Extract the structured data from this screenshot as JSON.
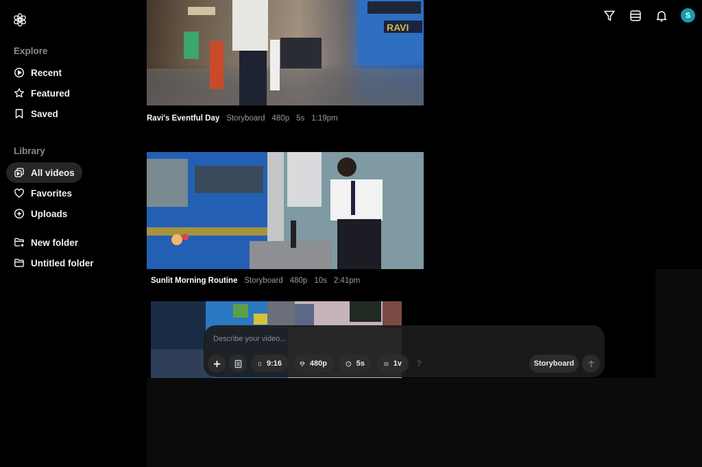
{
  "sidebar": {
    "logo": "openai-logo-icon",
    "explore_label": "Explore",
    "explore_items": [
      {
        "label": "Recent",
        "icon": "play-circle-icon"
      },
      {
        "label": "Featured",
        "icon": "star-icon"
      },
      {
        "label": "Saved",
        "icon": "bookmark-icon"
      }
    ],
    "library_label": "Library",
    "library_items": [
      {
        "label": "All videos",
        "icon": "videos-icon",
        "active": true
      },
      {
        "label": "Favorites",
        "icon": "heart-icon"
      },
      {
        "label": "Uploads",
        "icon": "plus-circle-icon"
      }
    ],
    "folder_items": [
      {
        "label": "New folder",
        "icon": "folder-plus-icon"
      },
      {
        "label": "Untitled folder",
        "icon": "folder-icon"
      }
    ]
  },
  "topbar": {
    "icons": [
      "filter-icon",
      "list-icon",
      "bell-icon"
    ],
    "avatar_initial": "S",
    "avatar_color": "#1a9aa8"
  },
  "videos": [
    {
      "title": "Ravi's Eventful Day",
      "type": "Storyboard",
      "resolution": "480p",
      "duration": "5s",
      "time": "1:19pm"
    },
    {
      "title": "Sunlit Morning Routine",
      "type": "Storyboard",
      "resolution": "480p",
      "duration": "10s",
      "time": "2:41pm"
    },
    {
      "title": "",
      "type": "",
      "resolution": "",
      "duration": "",
      "time": ""
    }
  ],
  "composer": {
    "placeholder": "Describe your video...",
    "aspect_ratio": "9:16",
    "resolution": "480p",
    "duration": "5s",
    "variations": "1v",
    "help": "?",
    "mode": "Storyboard"
  }
}
